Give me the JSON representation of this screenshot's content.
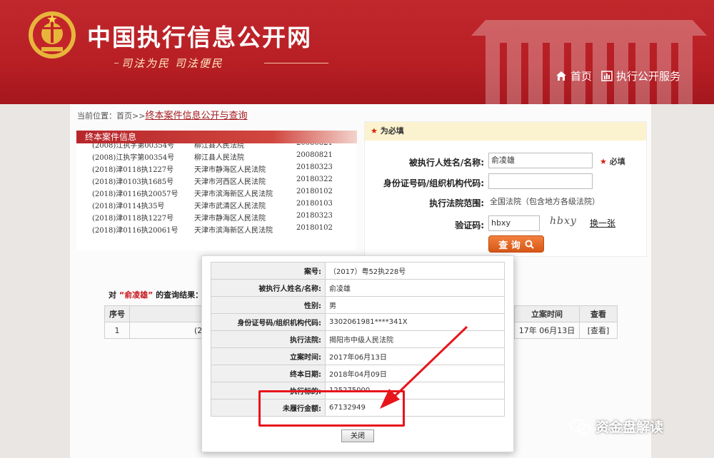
{
  "header": {
    "site_title": "中国执行信息公开网",
    "slogan": "司法为民  司法便民",
    "nav": [
      {
        "label": "首页",
        "icon": "home-icon"
      },
      {
        "label": "执行公开服务",
        "icon": "chart-icon"
      }
    ]
  },
  "breadcrumb": {
    "prefix": "当前位置：首页>>",
    "current": "终本案件信息公开与查询"
  },
  "case_list": {
    "title": "终本案件信息",
    "rows": [
      {
        "case_no": "(2008)江执字第00354号",
        "court": "柳江县人民法院",
        "date": "20080821"
      },
      {
        "case_no": "(2008)江执字第00354号",
        "court": "柳江县人民法院",
        "date": "20080821"
      },
      {
        "case_no": "(2018)津0118执1227号",
        "court": "天津市静海区人民法院",
        "date": "20180323"
      },
      {
        "case_no": "(2018)津0103执1685号",
        "court": "天津市河西区人民法院",
        "date": "20180322"
      },
      {
        "case_no": "(2018)津0116执20057号",
        "court": "天津市滨海新区人民法院",
        "date": "20180102"
      },
      {
        "case_no": "(2018)津0114执35号",
        "court": "天津市武清区人民法院",
        "date": "20180103"
      },
      {
        "case_no": "(2018)津0118执1227号",
        "court": "天津市静海区人民法院",
        "date": "20180323"
      },
      {
        "case_no": "(2018)津0116执20061号",
        "court": "天津市滨海新区人民法院",
        "date": "20180102"
      }
    ]
  },
  "form": {
    "required_note": "为必填",
    "name_label": "被执行人姓名/名称:",
    "name_value": "俞凌雄",
    "required_tag": "必填",
    "id_label": "身份证号码/组织机构代码:",
    "id_value": "",
    "court_label": "执行法院范围:",
    "court_value": "全国法院（包含地方各级法院）",
    "captcha_label": "验证码:",
    "captcha_value": "hbxy",
    "captcha_image_text": "hbxy",
    "refresh_label": "换一张",
    "query_button": "查 询"
  },
  "results": {
    "prefix": "对",
    "name": "“俞凌雄”",
    "suffix": "的查询结果：",
    "columns": [
      "序号",
      "",
      "立案时间",
      "查看"
    ],
    "rows": [
      {
        "index": "1",
        "case_partial": "(2",
        "date_partial": "17年 06月13日",
        "view": "[查看]"
      }
    ]
  },
  "detail_modal": {
    "fields": [
      {
        "key": "案号:",
        "value": "（2017）粤52执228号"
      },
      {
        "key": "被执行人姓名/名称:",
        "value": "俞凌雄"
      },
      {
        "key": "性别:",
        "value": "男"
      },
      {
        "key": "身份证号码/组织机构代码:",
        "value": "3302061981****341X"
      },
      {
        "key": "执行法院:",
        "value": "揭阳市中级人民法院"
      },
      {
        "key": "立案时间:",
        "value": "2017年06月13日"
      },
      {
        "key": "终本日期:",
        "value": "2018年04月09日"
      },
      {
        "key": "执行标的:",
        "value": "125275000"
      },
      {
        "key": "未履行金额:",
        "value": "67132949"
      }
    ],
    "close_button": "关闭"
  },
  "watermark": {
    "text": "资金盘解读",
    "icon": "wechat-icon"
  },
  "colors": {
    "brand_red": "#b81f25",
    "accent_orange": "#e0621f",
    "highlight_red": "#e8141c"
  }
}
